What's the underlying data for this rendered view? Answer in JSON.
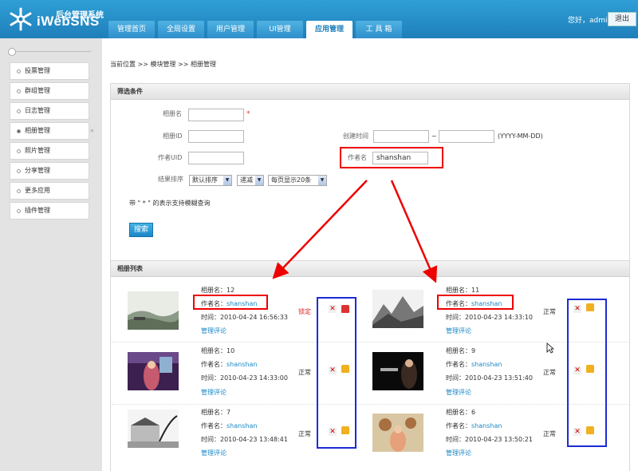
{
  "header": {
    "brand": "iWebSNS",
    "brand_sub": "后台管理系统",
    "welcome": "您好，admin",
    "logout": "退出",
    "tabs": [
      "管理首页",
      "全局设置",
      "用户管理",
      "UI管理",
      "应用管理",
      "工 具 箱"
    ],
    "active_tab": "应用管理"
  },
  "sidebar": {
    "items": [
      {
        "label": "投票管理"
      },
      {
        "label": "群组管理"
      },
      {
        "label": "日志管理"
      },
      {
        "label": "相册管理"
      },
      {
        "label": "照片管理"
      },
      {
        "label": "分享管理"
      },
      {
        "label": "更多应用"
      },
      {
        "label": "插件管理"
      }
    ],
    "active": "相册管理"
  },
  "breadcrumb": "当前位置 >> 模块管理 >> 相册管理",
  "filter": {
    "title": "筛选条件",
    "album_name_label": "相册名",
    "required_mark": "*",
    "album_id_label": "相册ID",
    "author_uid_label": "作者UID",
    "create_time_label": "创建时间",
    "date_sep": "~",
    "date_format": "(YYYY-MM-DD)",
    "author_name_label": "作者名",
    "author_name_value": "shanshan",
    "sort_label": "结果排序",
    "sort_field": "默认排序",
    "sort_order": "递减",
    "page_size": "每页显示20条",
    "fuzzy_note": "带 \" * \" 的表示支持模糊查询",
    "search_button": "搜索"
  },
  "album_list": {
    "title": "相册列表",
    "name_prefix": "相册名：",
    "author_prefix": "作者名：",
    "time_prefix": "时间：",
    "manage_comments": "管理评论",
    "albums": [
      {
        "name": "12",
        "author": "shanshan",
        "time": "2010-04-24 16:56:33",
        "status": "锁定",
        "locked": true
      },
      {
        "name": "11",
        "author": "shanshan",
        "time": "2010-04-23 14:33:10",
        "status": "正常",
        "locked": false
      },
      {
        "name": "10",
        "author": "shanshan",
        "time": "2010-04-23 14:33:00",
        "status": "正常",
        "locked": false
      },
      {
        "name": "9",
        "author": "shanshan",
        "time": "2010-04-23 13:51:40",
        "status": "正常",
        "locked": false
      },
      {
        "name": "7",
        "author": "shanshan",
        "time": "2010-04-23 13:48:41",
        "status": "正常",
        "locked": false
      },
      {
        "name": "6",
        "author": "shanshan",
        "time": "2010-04-23 13:50:21",
        "status": "正常",
        "locked": false
      }
    ]
  },
  "colors": {
    "header_blue": "#1f7fba",
    "link_blue": "#1a87c6",
    "annotation_red": "#e00000",
    "annotation_blue": "#1c2bd6",
    "locked_red": "#d22222"
  }
}
